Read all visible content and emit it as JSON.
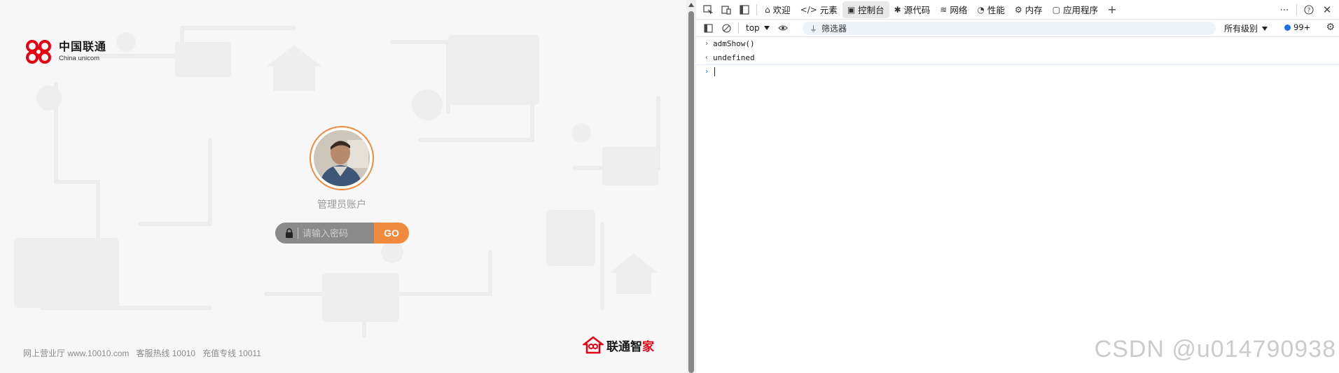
{
  "login": {
    "brand_cn": "中国联通",
    "brand_en": "China unicom",
    "account_label": "管理员账户",
    "password_placeholder": "请输入密码",
    "go_label": "GO",
    "footer": [
      "网上营业厅 www.10010.com",
      "客服热线 10010",
      "充值专线 10011"
    ],
    "zhijia_main": "联通智",
    "zhijia_accent": "家",
    "brand_color": "#e60012",
    "accent_color": "#f08a3c"
  },
  "devtools": {
    "tabs": [
      {
        "icon": "home-icon",
        "glyph": "⌂",
        "label": "欢迎"
      },
      {
        "icon": "elements-icon",
        "glyph": "</>",
        "label": "元素"
      },
      {
        "icon": "console-icon",
        "glyph": "▣",
        "label": "控制台"
      },
      {
        "icon": "sources-icon",
        "glyph": "⚙",
        "label": "源代码"
      },
      {
        "icon": "network-icon",
        "glyph": "≋",
        "label": "网络"
      },
      {
        "icon": "performance-icon",
        "glyph": "◔",
        "label": "性能"
      },
      {
        "icon": "memory-icon",
        "glyph": "⚙",
        "label": "内存"
      },
      {
        "icon": "application-icon",
        "glyph": "▢",
        "label": "应用程序"
      }
    ],
    "active_tab": "控制台",
    "context": "top",
    "filter_placeholder": "筛选器",
    "level": "所有级别",
    "issues_count": "99+",
    "console": {
      "input": "admShow()",
      "output": "undefined"
    }
  },
  "watermark": "CSDN @u014790938"
}
